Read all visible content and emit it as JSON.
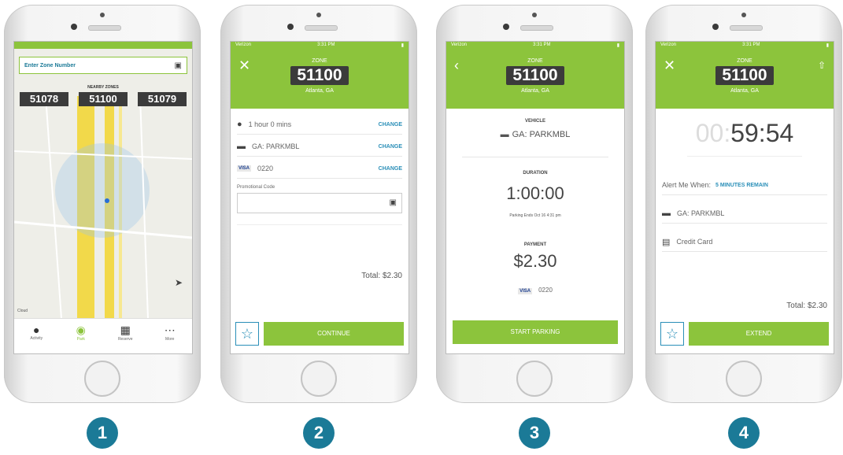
{
  "steps": [
    "1",
    "2",
    "3",
    "4"
  ],
  "colors": {
    "brand_green": "#8cc43c",
    "accent_blue": "#2a8fb8",
    "badge_teal": "#1b7a97",
    "zone_dark": "#3b3b3b"
  },
  "screen1": {
    "search_placeholder": "Enter Zone Number",
    "nearby_label": "NEARBY ZONES",
    "zones": [
      "51078",
      "51100",
      "51079"
    ],
    "map_brand": "Cloud",
    "tabs": [
      {
        "label": "Activity",
        "icon": "clock-icon"
      },
      {
        "label": "Park",
        "icon": "pin-icon"
      },
      {
        "label": "Reserve",
        "icon": "calendar-icon"
      },
      {
        "label": "More",
        "icon": "more-icon"
      }
    ]
  },
  "screen2": {
    "status_left": "Verizon",
    "status_time": "3:31 PM",
    "zone_label": "ZONE",
    "zone": "51100",
    "zone_location": "Atlanta, GA",
    "duration": "1 hour 0 mins",
    "vehicle": "GA: PARKMBL",
    "card": "0220",
    "change_label": "CHANGE",
    "promo_label": "Promotional Code",
    "total": "Total: $2.30",
    "continue_label": "CONTINUE"
  },
  "screen3": {
    "status_left": "Verizon",
    "status_time": "3:31 PM",
    "zone_label": "ZONE",
    "zone": "51100",
    "zone_location": "Atlanta, GA",
    "vehicle_heading": "VEHICLE",
    "vehicle": "GA: PARKMBL",
    "duration_heading": "DURATION",
    "duration": "1:00:00",
    "ends": "Parking Ends Oct 16 4:31 pm",
    "payment_heading": "PAYMENT",
    "amount": "$2.30",
    "card": "0220",
    "start_label": "START PARKING"
  },
  "screen4": {
    "status_left": "Verizon",
    "status_time": "3:31 PM",
    "zone_label": "ZONE",
    "zone": "51100",
    "zone_location": "Atlanta, GA",
    "timer_faint": "00",
    "timer": "59:54",
    "alert_label": "Alert Me When:",
    "alert_value": "5 MINUTES REMAIN",
    "vehicle": "GA: PARKMBL",
    "card_label": "Credit Card",
    "total": "Total: $2.30",
    "extend_label": "EXTEND"
  }
}
